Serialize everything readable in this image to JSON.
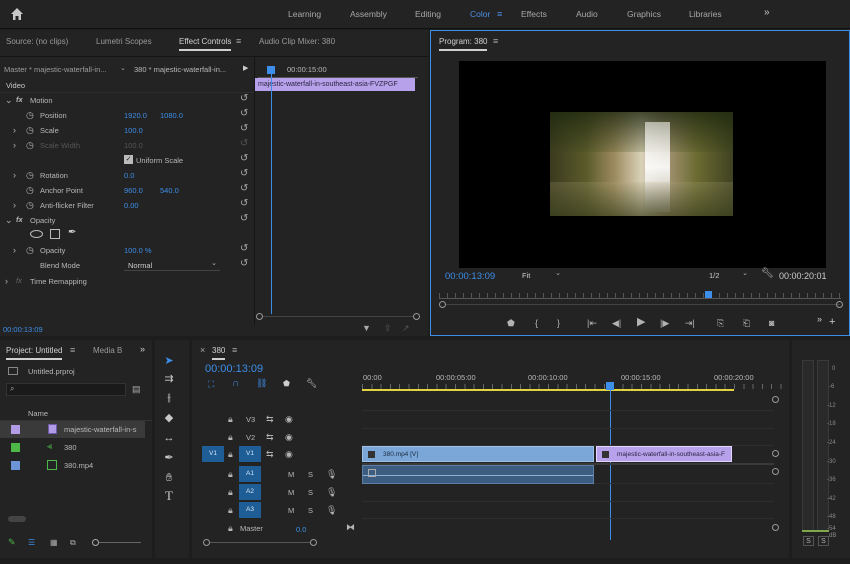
{
  "workspaces": [
    "Learning",
    "Assembly",
    "Editing",
    "Color",
    "Effects",
    "Audio",
    "Graphics",
    "Libraries"
  ],
  "active_workspace": "Color",
  "source_panel": {
    "tabs": [
      "Source: (no clips)",
      "Lumetri Scopes",
      "Effect Controls",
      "Audio Clip Mixer: 380"
    ],
    "master_label": "Master * majestic-waterfall-in...",
    "sequence_label": "380 * majestic-waterfall-in...",
    "timecode_ruler": "00:00:15:00",
    "clip_name": "majestic-waterfall-in-southeast-asia-FVZPGF",
    "section_video": "Video",
    "motion": "Motion",
    "position_label": "Position",
    "position_x": "1920.0",
    "position_y": "1080.0",
    "scale_label": "Scale",
    "scale_value": "100.0",
    "scale_width_label": "Scale Width",
    "scale_width_value": "100.0",
    "uniform_scale_label": "Uniform Scale",
    "rotation_label": "Rotation",
    "rotation_value": "0.0",
    "anchor_label": "Anchor Point",
    "anchor_x": "960.0",
    "anchor_y": "540.0",
    "antiflicker_label": "Anti-flicker Filter",
    "antiflicker_value": "0.00",
    "opacity_section": "Opacity",
    "opacity_label": "Opacity",
    "opacity_value": "100.0 %",
    "blend_label": "Blend Mode",
    "blend_value": "Normal",
    "time_remapping": "Time Remapping",
    "current_time": "00:00:13:09"
  },
  "program": {
    "title": "Program: 380",
    "timecode": "00:00:13:09",
    "fit": "Fit",
    "quality": "1/2",
    "duration": "00:00:20:01"
  },
  "project": {
    "tabs": [
      "Project: Untitled",
      "Media B"
    ],
    "file": "Untitled.prproj",
    "column_name": "Name",
    "items": [
      {
        "name": "majestic-waterfall-in-s",
        "color": "#b39ce6"
      },
      {
        "name": "380",
        "color": "#4db848"
      },
      {
        "name": "380.mp4",
        "color": "#6b95d6"
      }
    ]
  },
  "timeline": {
    "sequence": "380",
    "timecode": "00:00:13:09",
    "ruler": [
      "00:00",
      "00:00:05:00",
      "00:00:10:00",
      "00:00:15:00",
      "00:00:20:00"
    ],
    "video_tracks": [
      "V3",
      "V2",
      "V1"
    ],
    "audio_tracks": [
      "A1",
      "A2",
      "A3"
    ],
    "source_patch_v": "V1",
    "master_label": "Master",
    "master_value": "0.0",
    "clip_video": "380.mp4 [V]",
    "clip_waterfall": "majestic-waterfall-in-southeast-asia-F",
    "mute": "M",
    "solo": "S"
  },
  "audio_meter": {
    "scale": [
      "0",
      "-6",
      "-12",
      "-18",
      "-24",
      "-30",
      "-36",
      "-42",
      "-48",
      "-54",
      "dB"
    ],
    "solo_buttons": [
      "S",
      "S"
    ]
  },
  "colors": {
    "accent": "#3d8ee8",
    "clip_video": "#7aa7d8",
    "clip_purple": "#b7a1ea",
    "audio_track": "#1e5d96",
    "playhead": "#3d8ee8"
  }
}
